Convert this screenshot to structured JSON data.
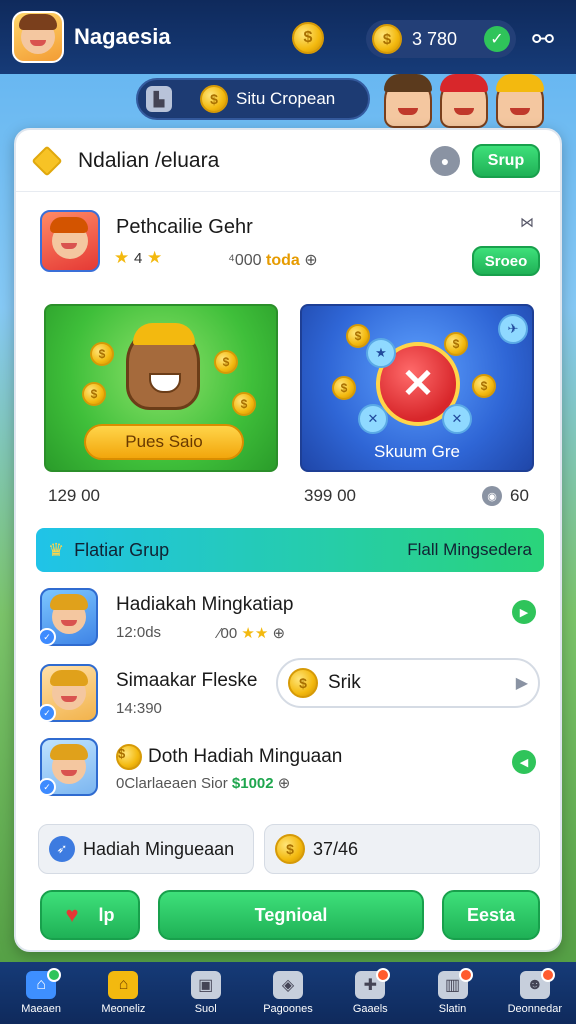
{
  "topbar": {
    "title": "Nagaesia",
    "balance": "3 780",
    "coin_icon": "coin-icon",
    "check_icon": "check-icon",
    "menu_icon": "menu-icon"
  },
  "subpill": {
    "label": "Situ Cropean",
    "icon": "page-icon"
  },
  "card": {
    "title": "Ndalian /eluara",
    "head_button": "Srup"
  },
  "featured_game": {
    "name": "Pethcailie Gehr",
    "rating": "4",
    "meta_prefix": "⁴000",
    "meta_highlight": "toda",
    "button": "Sroeo"
  },
  "promos": {
    "left_button": "Pues Saio",
    "right_label": "Skuum Gre",
    "left_amount": "129 00",
    "right_amount": "399 00",
    "views": "60"
  },
  "banner": {
    "left": "Flatiar Grup",
    "right": "Flall Mingsedera"
  },
  "list": [
    {
      "name": "Hadiakah Mingkatiap",
      "sub": "12:0ds",
      "sub2": "⁄00"
    },
    {
      "name": "Simaakar Fleske",
      "sub": "14:390",
      "search_text": "Srik"
    },
    {
      "name": "Doth Hadiah Minguaan",
      "sub_prefix": "0Clarlaeaen Sior",
      "sub_value": "$1002"
    }
  ],
  "chips": {
    "left": "Hadiah Mingueaan",
    "right": "37/46"
  },
  "buttons": {
    "left": "lp",
    "center": "Tegnioal",
    "right": "Eesta"
  },
  "nav": [
    {
      "label": "Maeaen",
      "icon": "home-icon"
    },
    {
      "label": "Meoneliz",
      "icon": "house-icon"
    },
    {
      "label": "Suol",
      "icon": "box-icon"
    },
    {
      "label": "Pagoones",
      "icon": "photo-icon"
    },
    {
      "label": "Gaaels",
      "icon": "game-icon"
    },
    {
      "label": "Slatin",
      "icon": "chart-icon"
    },
    {
      "label": "Deonnedar",
      "icon": "person-icon"
    }
  ],
  "colors": {
    "topbar": "#163b78",
    "accent_green": "#2fc45a",
    "gold": "#f3b90f"
  }
}
